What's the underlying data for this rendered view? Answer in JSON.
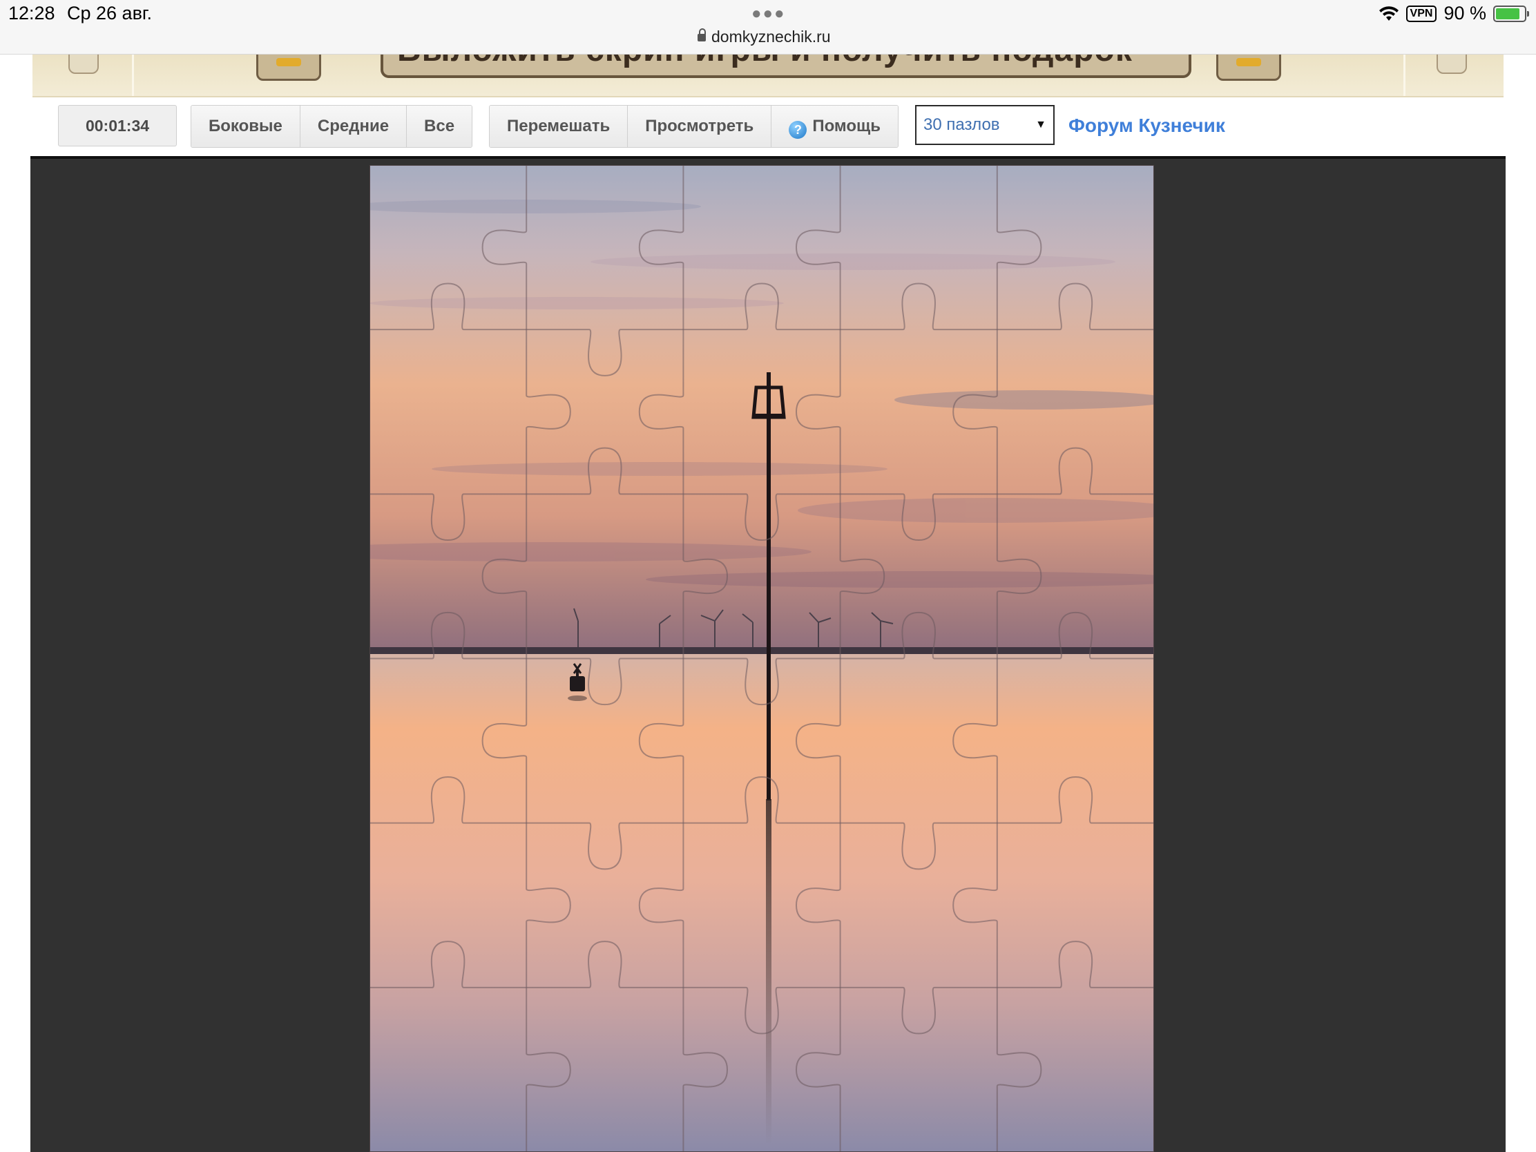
{
  "status_bar": {
    "time": "12:28",
    "date": "Ср 26 авг.",
    "url": "domkyznechik.ru",
    "vpn": "VPN",
    "battery_text": "90 %",
    "battery_level": 0.9
  },
  "banner": {
    "text": "Выложить скрин игры и получить подарок"
  },
  "toolbar": {
    "timer": "00:01:34",
    "filters": [
      "Боковые",
      "Средние",
      "Все"
    ],
    "actions": [
      "Перемешать",
      "Просмотреть",
      "Помощь"
    ],
    "pieces_select": "30 пазлов",
    "forum_link": "Форум Кузнечик"
  },
  "puzzle": {
    "columns": 5,
    "rows": 6,
    "pieces": 30,
    "image_colors": {
      "sky_top": "#a7adc1",
      "sky_mid": "#eab28f",
      "horizon": "#8f6f7d",
      "water_top": "#f4b287",
      "water_bottom": "#8b8aa8"
    }
  }
}
